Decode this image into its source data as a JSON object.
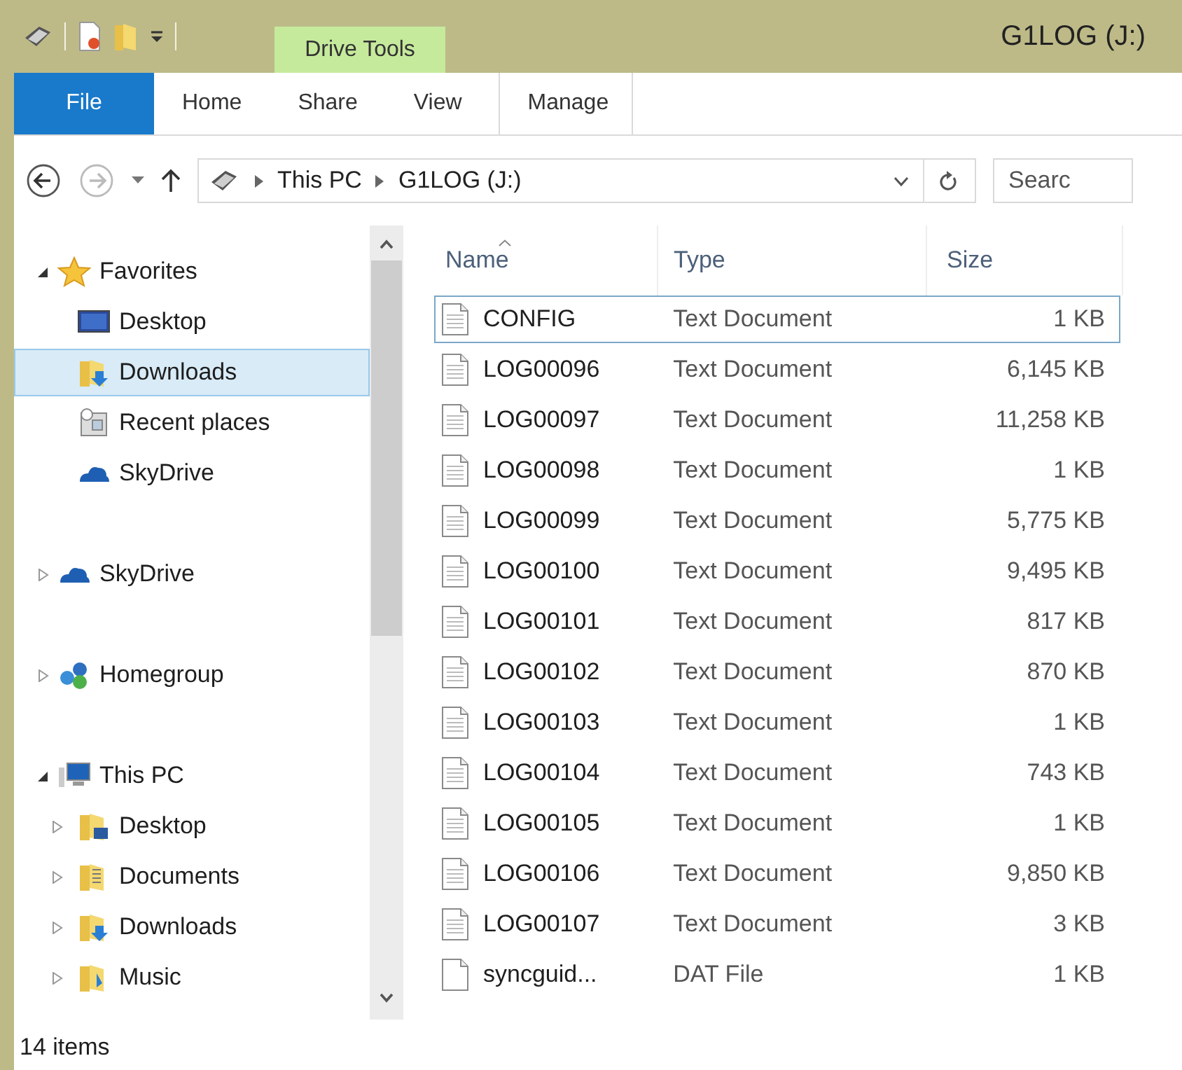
{
  "window": {
    "title": "G1LOG (J:)"
  },
  "context_tab": {
    "label": "Drive Tools"
  },
  "ribbon_tabs": [
    {
      "label": "File",
      "kind": "file",
      "selected": false
    },
    {
      "label": "Home",
      "kind": "normal",
      "selected": false
    },
    {
      "label": "Share",
      "kind": "normal",
      "selected": false
    },
    {
      "label": "View",
      "kind": "normal",
      "selected": false
    },
    {
      "label": "Manage",
      "kind": "context",
      "selected": false
    }
  ],
  "address": {
    "crumbs": [
      "This PC",
      "G1LOG (J:)"
    ]
  },
  "search": {
    "placeholder": "Searc"
  },
  "nav": [
    {
      "label": "Favorites",
      "kind": "star",
      "expanded": true,
      "selected": false,
      "children": [
        {
          "label": "Desktop",
          "kind": "desktop",
          "selected": false
        },
        {
          "label": "Downloads",
          "kind": "downloads",
          "selected": true
        },
        {
          "label": "Recent places",
          "kind": "recent",
          "selected": false
        },
        {
          "label": "SkyDrive",
          "kind": "cloud",
          "selected": false
        }
      ]
    },
    {
      "label": "SkyDrive",
      "kind": "cloud",
      "expanded": false,
      "selected": false
    },
    {
      "label": "Homegroup",
      "kind": "network",
      "expanded": false,
      "selected": false
    },
    {
      "label": "This PC",
      "kind": "computer",
      "expanded": true,
      "selected": false,
      "children": [
        {
          "label": "Desktop",
          "kind": "desktop-folder",
          "expanded": false,
          "selected": false
        },
        {
          "label": "Documents",
          "kind": "documents",
          "expanded": false,
          "selected": false
        },
        {
          "label": "Downloads",
          "kind": "downloads",
          "expanded": false,
          "selected": false
        },
        {
          "label": "Music",
          "kind": "music",
          "expanded": false,
          "selected": false
        }
      ]
    }
  ],
  "table": {
    "columns": [
      "Name",
      "Type",
      "Size"
    ],
    "rows": [
      {
        "name": "CONFIG",
        "type": "Text Document",
        "size": "1 KB",
        "kind": "text",
        "focused": true
      },
      {
        "name": "LOG00096",
        "type": "Text Document",
        "size": "6,145 KB",
        "kind": "text",
        "focused": false
      },
      {
        "name": "LOG00097",
        "type": "Text Document",
        "size": "11,258 KB",
        "kind": "text",
        "focused": false
      },
      {
        "name": "LOG00098",
        "type": "Text Document",
        "size": "1 KB",
        "kind": "text",
        "focused": false
      },
      {
        "name": "LOG00099",
        "type": "Text Document",
        "size": "5,775 KB",
        "kind": "text",
        "focused": false
      },
      {
        "name": "LOG00100",
        "type": "Text Document",
        "size": "9,495 KB",
        "kind": "text",
        "focused": false
      },
      {
        "name": "LOG00101",
        "type": "Text Document",
        "size": "817 KB",
        "kind": "text",
        "focused": false
      },
      {
        "name": "LOG00102",
        "type": "Text Document",
        "size": "870 KB",
        "kind": "text",
        "focused": false
      },
      {
        "name": "LOG00103",
        "type": "Text Document",
        "size": "1 KB",
        "kind": "text",
        "focused": false
      },
      {
        "name": "LOG00104",
        "type": "Text Document",
        "size": "743 KB",
        "kind": "text",
        "focused": false
      },
      {
        "name": "LOG00105",
        "type": "Text Document",
        "size": "1 KB",
        "kind": "text",
        "focused": false
      },
      {
        "name": "LOG00106",
        "type": "Text Document",
        "size": "9,850 KB",
        "kind": "text",
        "focused": false
      },
      {
        "name": "LOG00107",
        "type": "Text Document",
        "size": "3 KB",
        "kind": "text",
        "focused": false
      },
      {
        "name": "syncguid...",
        "type": "DAT File",
        "size": "1 KB",
        "kind": "file",
        "focused": false
      }
    ]
  },
  "status_bar": {
    "text": "14 items"
  }
}
